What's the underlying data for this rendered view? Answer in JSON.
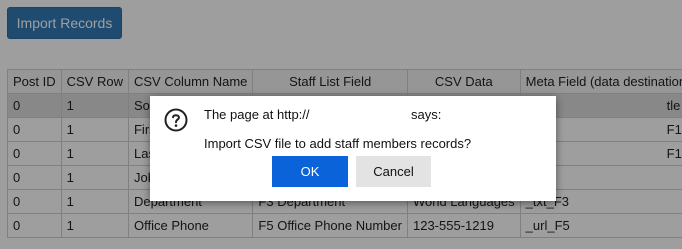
{
  "toolbar": {
    "import_label": "Import Records"
  },
  "table": {
    "headers": [
      "Post ID",
      "CSV Row",
      "CSV Column Name",
      "Staff List Field",
      "CSV Data",
      "Meta Field (data destination)"
    ],
    "rows": [
      [
        "0",
        "1",
        "Sort T",
        "",
        "",
        "tle"
      ],
      [
        "0",
        "1",
        "First N",
        "",
        "",
        "F1"
      ],
      [
        "0",
        "1",
        "Last N",
        "",
        "",
        "F1"
      ],
      [
        "0",
        "1",
        "Job T",
        "",
        "",
        ""
      ],
      [
        "0",
        "1",
        "Department",
        "F3 Department",
        "World Languages",
        "_txt_F3"
      ],
      [
        "0",
        "1",
        "Office Phone",
        "F5 Office Phone Number",
        "123-555-1219",
        "_url_F5"
      ]
    ]
  },
  "dialog": {
    "title_prefix": "The page at http://",
    "title_suffix": "says:",
    "message": "Import CSV file to add staff members records?",
    "ok_label": "OK",
    "cancel_label": "Cancel",
    "icon": "question-circle-icon"
  }
}
